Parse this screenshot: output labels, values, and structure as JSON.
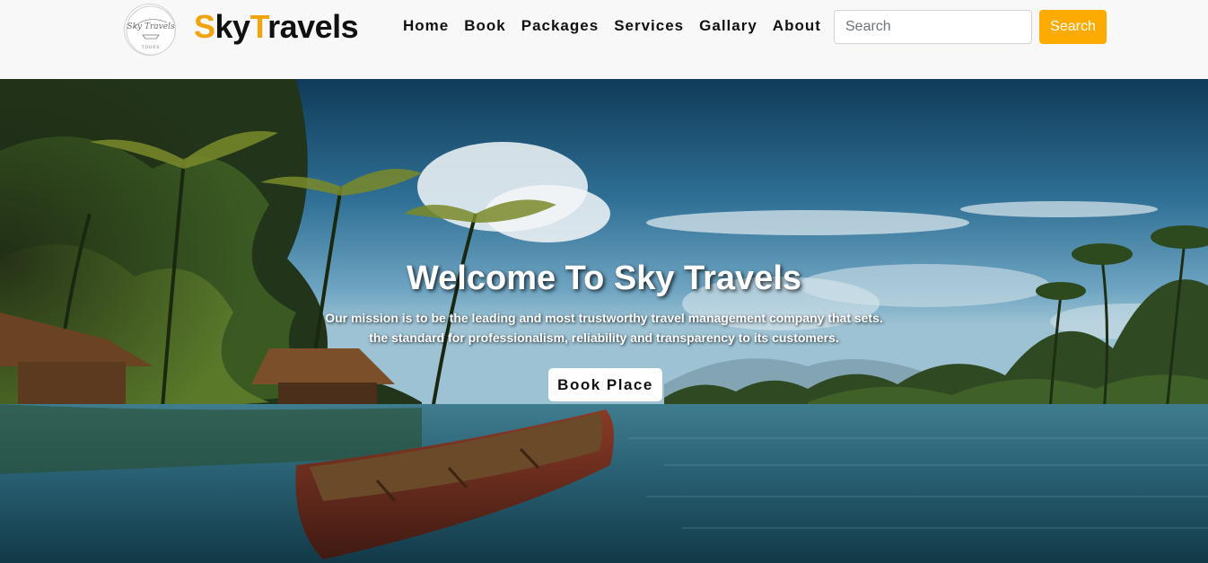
{
  "navbar": {
    "logo": {
      "text": "Sky Travels",
      "subtext": "TOURS"
    },
    "brand": {
      "part1": "S",
      "part2": "ky",
      "part3": "T",
      "part4": "ravels"
    },
    "links": [
      "Home",
      "Book",
      "Packages",
      "Services",
      "Gallary",
      "About"
    ],
    "search": {
      "placeholder": "Search",
      "value": "",
      "button_label": "Search"
    }
  },
  "hero": {
    "title": "Welcome To Sky Travels",
    "text_line1": "Our mission is to be the leading and most trustworthy travel management company that sets.",
    "text_line2": "the standard for professionalism, reliability and transparency to its customers.",
    "button_label": "Book Place"
  },
  "colors": {
    "accent": "#fdab00",
    "brand_orange": "#f2a40c",
    "navbar_bg": "#f8f8f8",
    "text_dark": "#111111"
  }
}
